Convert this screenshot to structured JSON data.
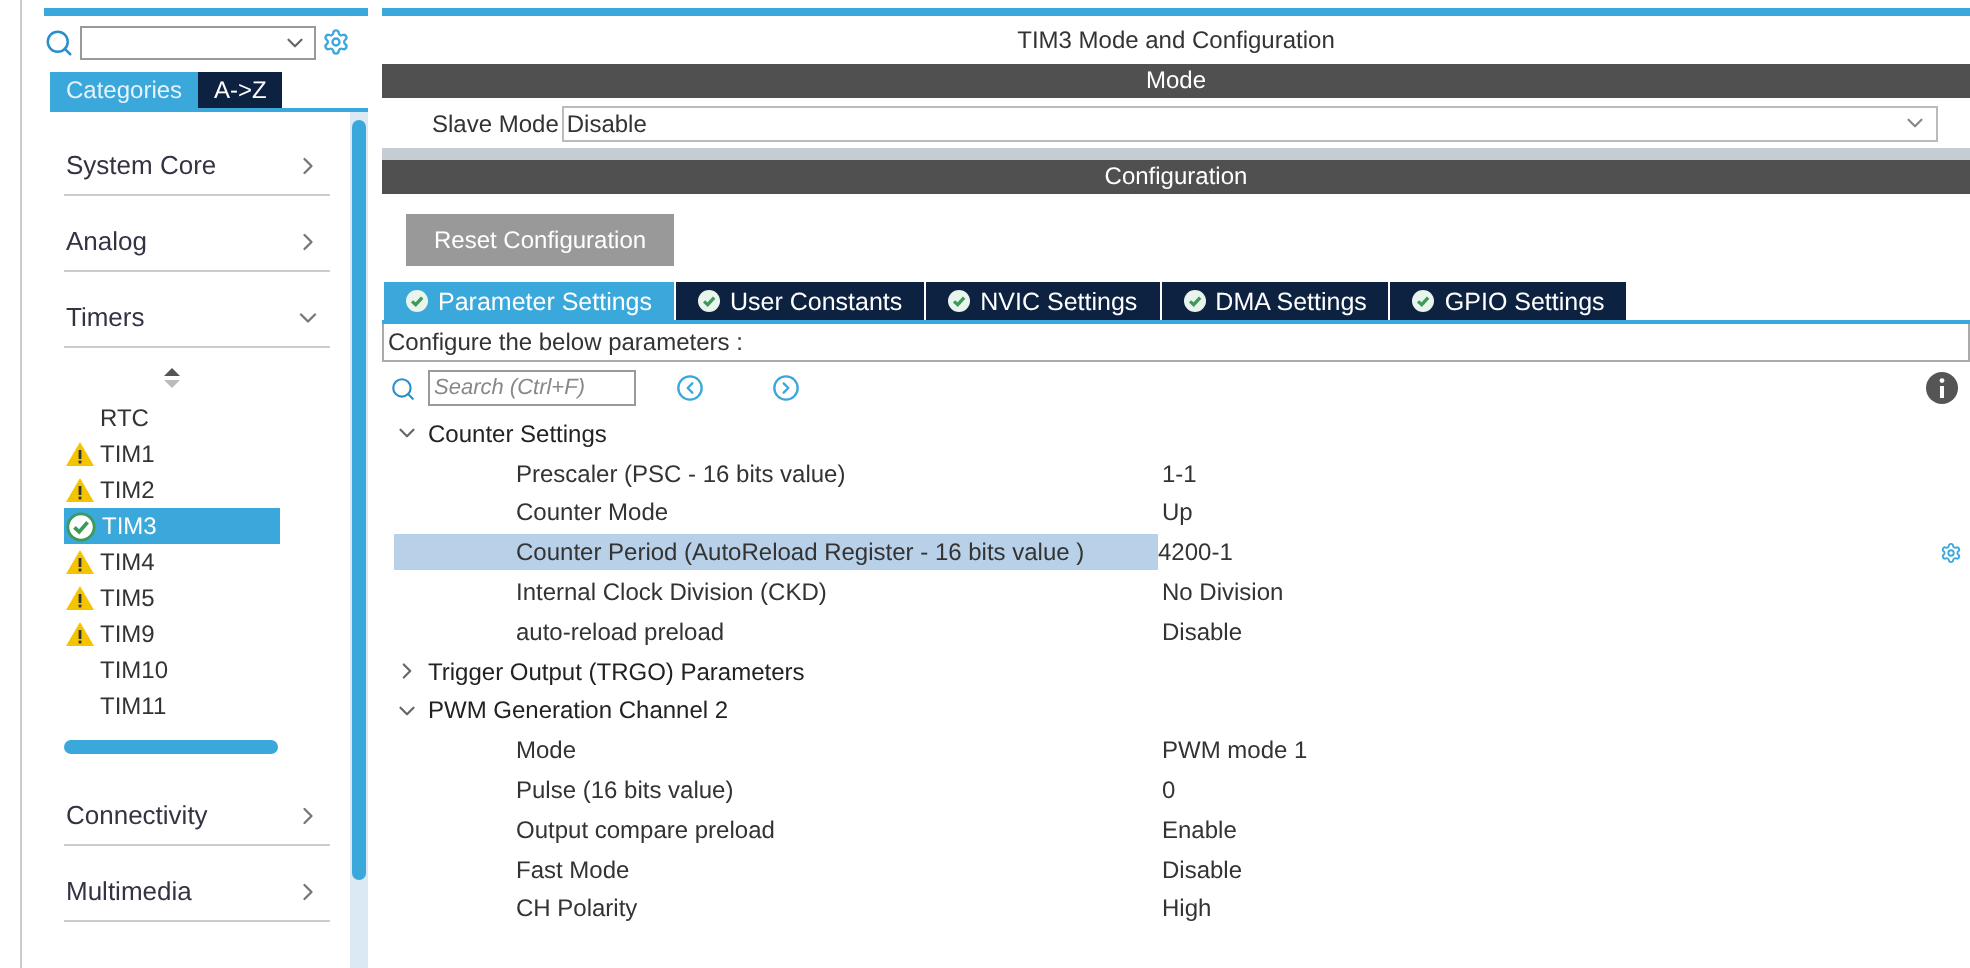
{
  "sidebar": {
    "tabs": [
      {
        "label": "Categories",
        "selected": true
      },
      {
        "label": "A->Z",
        "selected": false
      }
    ],
    "categories": [
      {
        "label": "System Core",
        "expanded": false
      },
      {
        "label": "Analog",
        "expanded": false
      },
      {
        "label": "Timers",
        "expanded": true,
        "items": [
          {
            "label": "RTC",
            "kind": "plain",
            "selected": false
          },
          {
            "label": "TIM1",
            "kind": "warning",
            "selected": false
          },
          {
            "label": "TIM2",
            "kind": "warning",
            "selected": false
          },
          {
            "label": "TIM3",
            "kind": "ok",
            "selected": true
          },
          {
            "label": "TIM4",
            "kind": "warning",
            "selected": false
          },
          {
            "label": "TIM5",
            "kind": "warning",
            "selected": false
          },
          {
            "label": "TIM9",
            "kind": "warning",
            "selected": false
          },
          {
            "label": "TIM10",
            "kind": "plain",
            "selected": false
          },
          {
            "label": "TIM11",
            "kind": "plain",
            "selected": false
          }
        ]
      },
      {
        "label": "Connectivity",
        "expanded": false
      },
      {
        "label": "Multimedia",
        "expanded": false
      }
    ]
  },
  "main": {
    "title": "TIM3 Mode and Configuration",
    "mode_header": "Mode",
    "slave_mode": {
      "label": "Slave Mode",
      "value": "Disable"
    },
    "config_header": "Configuration",
    "reset_button": "Reset Configuration",
    "tabs": [
      {
        "label": "Parameter Settings",
        "selected": true
      },
      {
        "label": "User Constants",
        "selected": false
      },
      {
        "label": "NVIC Settings",
        "selected": false
      },
      {
        "label": "DMA Settings",
        "selected": false
      },
      {
        "label": "GPIO Settings",
        "selected": false
      }
    ],
    "hint": "Configure the below parameters :",
    "search": {
      "placeholder": "Search (Ctrl+F)"
    },
    "tree": [
      {
        "label": "Counter Settings",
        "expanded": true,
        "children": [
          {
            "name": "Prescaler (PSC - 16 bits value)",
            "value": "1-1",
            "selected": false
          },
          {
            "name": "Counter Mode",
            "value": "Up",
            "selected": false
          },
          {
            "name": "Counter Period (AutoReload Register - 16 bits value )",
            "value": "4200-1",
            "selected": true
          },
          {
            "name": "Internal Clock Division (CKD)",
            "value": "No Division",
            "selected": false
          },
          {
            "name": "auto-reload preload",
            "value": "Disable",
            "selected": false
          }
        ]
      },
      {
        "label": "Trigger Output (TRGO) Parameters",
        "expanded": false
      },
      {
        "label": "PWM Generation Channel 2",
        "expanded": true,
        "children": [
          {
            "name": "Mode",
            "value": "PWM mode 1",
            "selected": false
          },
          {
            "name": "Pulse (16 bits value)",
            "value": "0",
            "selected": false
          },
          {
            "name": "Output compare preload",
            "value": "Enable",
            "selected": false
          },
          {
            "name": "Fast Mode",
            "value": "Disable",
            "selected": false
          },
          {
            "name": "CH Polarity",
            "value": "High",
            "selected": false
          }
        ]
      }
    ]
  }
}
